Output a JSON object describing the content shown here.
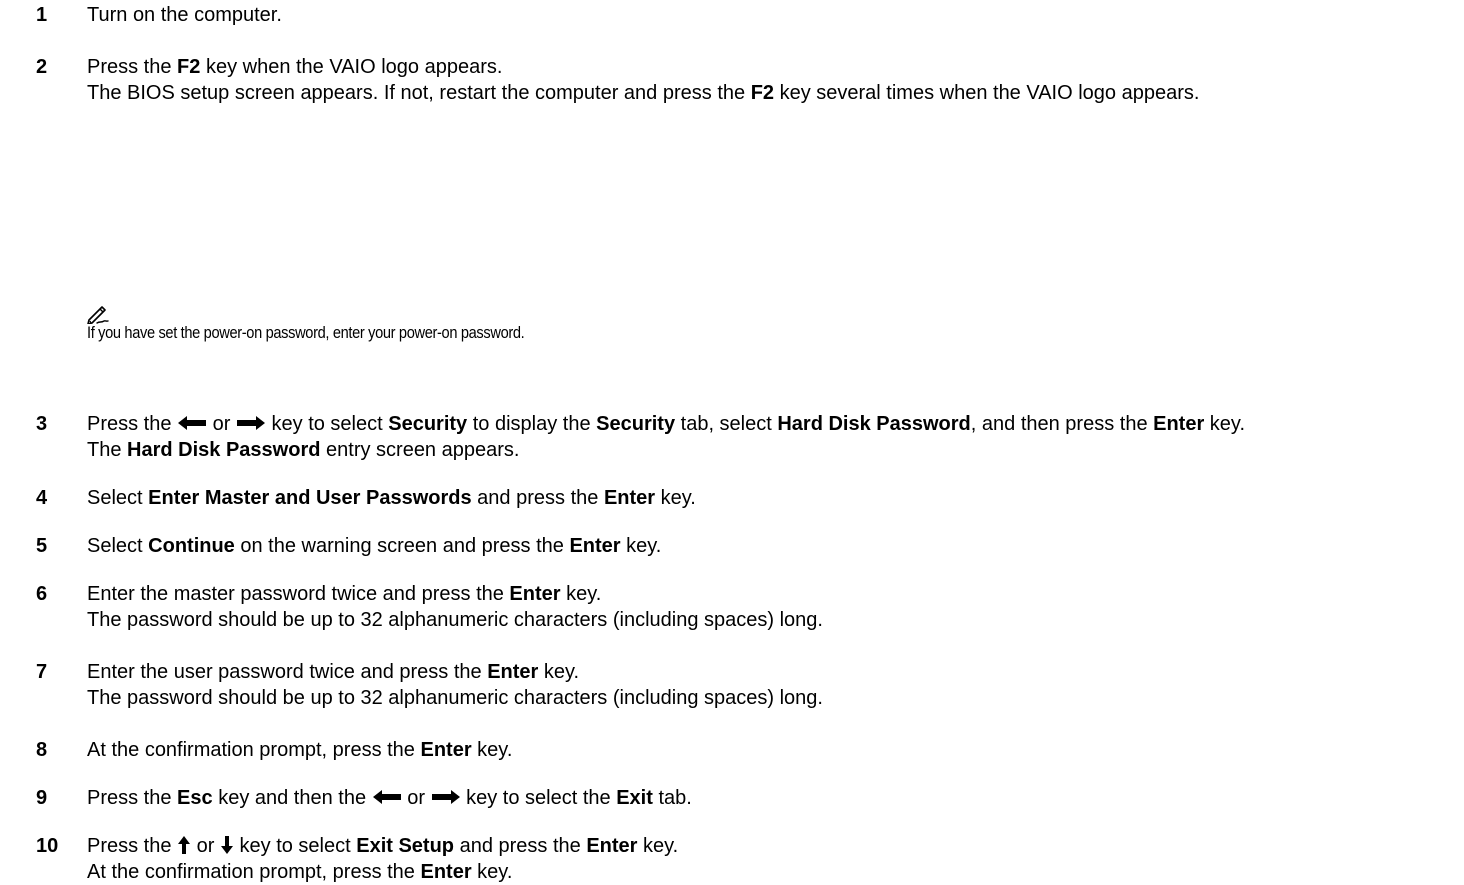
{
  "steps": [
    {
      "number": "1",
      "lines": [
        {
          "segments": [
            {
              "text": "Turn on the computer."
            }
          ]
        }
      ]
    },
    {
      "number": "2",
      "lines": [
        {
          "segments": [
            {
              "text": "Press the "
            },
            {
              "text": "F2",
              "bold": true
            },
            {
              "text": " key when the VAIO logo appears."
            }
          ]
        },
        {
          "wrap": true,
          "segments": [
            {
              "text": "The BIOS setup screen appears. If not, restart the computer and press the "
            },
            {
              "text": "F2",
              "bold": true
            },
            {
              "text": " key several times when the VAIO logo appears."
            }
          ]
        }
      ]
    },
    {
      "number": "3",
      "lines": [
        {
          "wrap": true,
          "segments": [
            {
              "text": "Press the "
            },
            {
              "arrow": "left-arrow-icon"
            },
            {
              "text": " or "
            },
            {
              "arrow": "right-arrow-icon"
            },
            {
              "text": " key to select "
            },
            {
              "text": "Security",
              "bold": true
            },
            {
              "text": " to display the "
            },
            {
              "text": "Security",
              "bold": true
            },
            {
              "text": " tab, select "
            },
            {
              "text": "Hard Disk Password",
              "bold": true
            },
            {
              "text": ", and then press the "
            },
            {
              "text": "Enter",
              "bold": true
            },
            {
              "text": " key."
            }
          ]
        },
        {
          "segments": [
            {
              "text": "The "
            },
            {
              "text": "Hard Disk Password",
              "bold": true
            },
            {
              "text": " entry screen appears."
            }
          ]
        }
      ]
    },
    {
      "number": "4",
      "lines": [
        {
          "segments": [
            {
              "text": "Select "
            },
            {
              "text": "Enter Master and User Passwords",
              "bold": true
            },
            {
              "text": " and press the "
            },
            {
              "text": "Enter",
              "bold": true
            },
            {
              "text": " key."
            }
          ]
        }
      ]
    },
    {
      "number": "5",
      "lines": [
        {
          "segments": [
            {
              "text": "Select "
            },
            {
              "text": "Continue",
              "bold": true
            },
            {
              "text": " on the warning screen and press the "
            },
            {
              "text": "Enter",
              "bold": true
            },
            {
              "text": " key."
            }
          ]
        }
      ]
    },
    {
      "number": "6",
      "lines": [
        {
          "segments": [
            {
              "text": "Enter the master password twice and press the "
            },
            {
              "text": "Enter",
              "bold": true
            },
            {
              "text": " key."
            }
          ]
        },
        {
          "segments": [
            {
              "text": "The password should be up to 32 alphanumeric characters (including spaces) long."
            }
          ]
        }
      ]
    },
    {
      "number": "7",
      "lines": [
        {
          "segments": [
            {
              "text": "Enter the user password twice and press the "
            },
            {
              "text": "Enter",
              "bold": true
            },
            {
              "text": " key."
            }
          ]
        },
        {
          "segments": [
            {
              "text": "The password should be up to 32 alphanumeric characters (including spaces) long."
            }
          ]
        }
      ]
    },
    {
      "number": "8",
      "lines": [
        {
          "segments": [
            {
              "text": "At the confirmation prompt, press the "
            },
            {
              "text": "Enter",
              "bold": true
            },
            {
              "text": " key."
            }
          ]
        }
      ]
    },
    {
      "number": "9",
      "lines": [
        {
          "segments": [
            {
              "text": "Press the "
            },
            {
              "text": "Esc",
              "bold": true
            },
            {
              "text": " key and then the "
            },
            {
              "arrow": "left-arrow-icon"
            },
            {
              "text": " or "
            },
            {
              "arrow": "right-arrow-icon"
            },
            {
              "text": " key to select the "
            },
            {
              "text": "Exit",
              "bold": true
            },
            {
              "text": " tab."
            }
          ]
        }
      ]
    },
    {
      "number": "10",
      "lines": [
        {
          "segments": [
            {
              "text": "Press the "
            },
            {
              "arrow": "up-arrow-icon"
            },
            {
              "text": " or "
            },
            {
              "arrow": "down-arrow-icon"
            },
            {
              "text": " key to select "
            },
            {
              "text": "Exit Setup",
              "bold": true
            },
            {
              "text": " and press the "
            },
            {
              "text": "Enter",
              "bold": true
            },
            {
              "text": " key."
            }
          ]
        },
        {
          "segments": [
            {
              "text": "At the confirmation prompt, press the "
            },
            {
              "text": "Enter",
              "bold": true
            },
            {
              "text": " key."
            }
          ]
        }
      ]
    }
  ],
  "note": {
    "icon": "pencil-note-icon",
    "text": "If you have set the power-on password, enter your power-on password."
  }
}
